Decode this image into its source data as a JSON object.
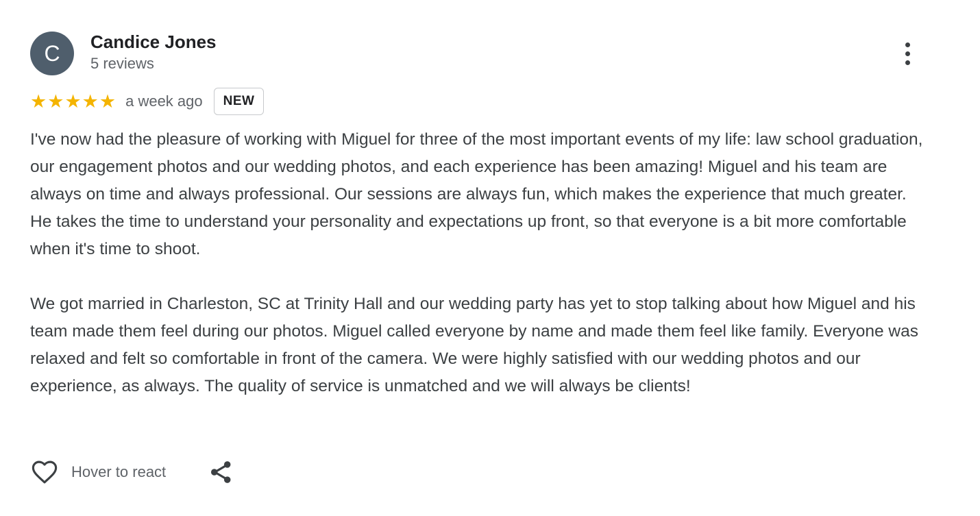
{
  "review": {
    "avatar_letter": "C",
    "author_name": "Candice Jones",
    "author_reviews": "5 reviews",
    "rating": 5,
    "rating_max": 5,
    "time_ago": "a week ago",
    "badge": "NEW",
    "paragraphs": [
      "I've now had the pleasure of working with Miguel for three of the most important events of my life: law school graduation, our engagement photos and our wedding photos, and each experience has been amazing! Miguel and his team are always on time and always professional. Our sessions are always fun, which makes the experience that much greater. He takes the time to understand your personality and expectations up front, so that everyone is a bit more comfortable when it's time to shoot.",
      "We got married in Charleston, SC at Trinity Hall and our wedding party has yet to stop talking about how Miguel and his team made them feel during our photos. Miguel called everyone by name and made them feel like family. Everyone was relaxed and felt so comfortable in front of the camera. We were highly satisfied with our wedding photos and our experience, as always. The quality of service is unmatched and we will always be clients!"
    ],
    "react_label": "Hover to react"
  },
  "icons": {
    "more": "more-vert-icon",
    "star": "star-icon",
    "heart": "heart-outline-icon",
    "share": "share-icon"
  },
  "colors": {
    "avatar_bg": "#4f5e6c",
    "star": "#f4b400",
    "muted_text": "#5f6368",
    "body_text": "#3c4043"
  }
}
